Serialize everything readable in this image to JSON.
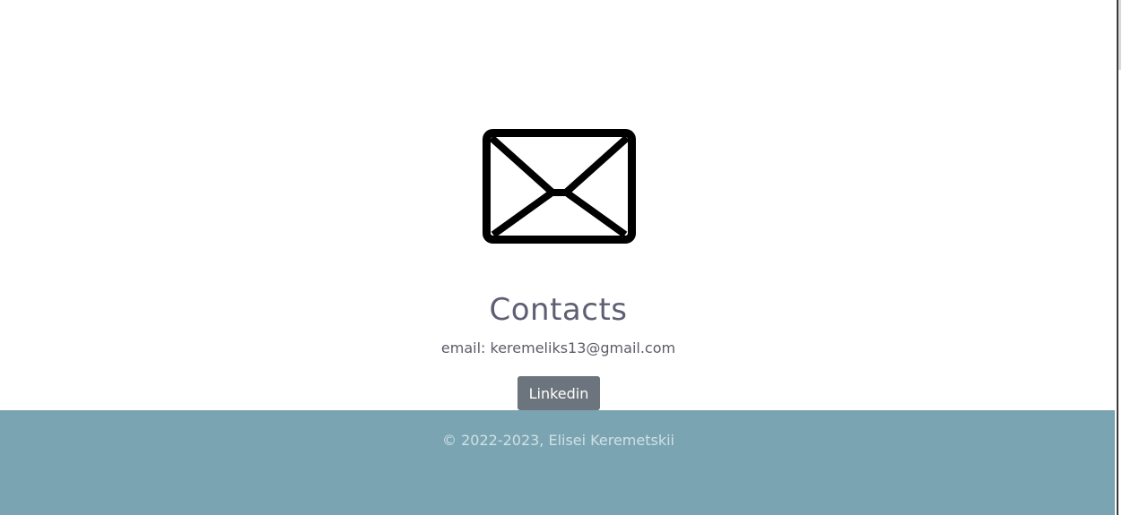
{
  "contacts": {
    "icon": "envelope-icon",
    "heading": "Contacts",
    "email_text": "email: keremeliks13@gmail.com",
    "linkedin_label": "Linkedin"
  },
  "footer": {
    "copyright": "© 2022-2023, Elisei Keremetskii",
    "background_color": "#7ba4b2"
  },
  "colors": {
    "button": "#6c757d",
    "heading": "#5e5f73"
  }
}
